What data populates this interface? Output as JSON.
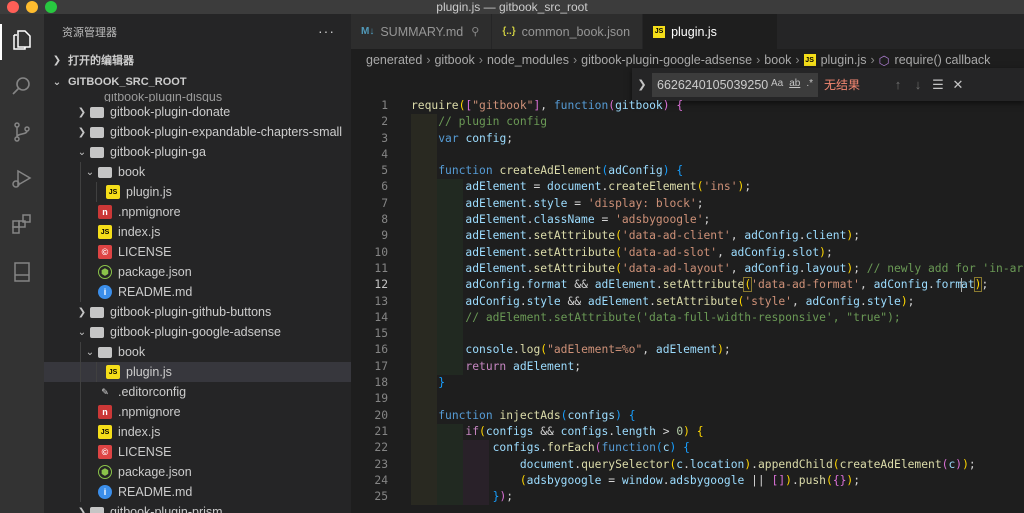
{
  "window": {
    "title": "plugin.js — gitbook_src_root"
  },
  "sidebar": {
    "header": "资源管理器",
    "more": "···",
    "open_editors": "打开的编辑器",
    "root": "GITBOOK_SRC_ROOT",
    "partial": "gitbook-plugin-disqus",
    "items": [
      {
        "label": "gitbook-plugin-donate"
      },
      {
        "label": "gitbook-plugin-expandable-chapters-small"
      },
      {
        "label": "gitbook-plugin-ga"
      },
      {
        "label": "book"
      },
      {
        "label": "plugin.js"
      },
      {
        "label": ".npmignore"
      },
      {
        "label": "index.js"
      },
      {
        "label": "LICENSE"
      },
      {
        "label": "package.json"
      },
      {
        "label": "README.md"
      },
      {
        "label": "gitbook-plugin-github-buttons"
      },
      {
        "label": "gitbook-plugin-google-adsense"
      },
      {
        "label": "book"
      },
      {
        "label": "plugin.js"
      },
      {
        "label": ".editorconfig"
      },
      {
        "label": ".npmignore"
      },
      {
        "label": "index.js"
      },
      {
        "label": "LICENSE"
      },
      {
        "label": "package.json"
      },
      {
        "label": "README.md"
      },
      {
        "label": "gitbook-plugin-prism"
      }
    ]
  },
  "tabs": [
    {
      "icon": "M↓",
      "label": "SUMMARY.md",
      "color": "#519aba"
    },
    {
      "icon": "{..}",
      "label": "common_book.json",
      "color": "#cbcb41"
    },
    {
      "icon": "JS",
      "label": "plugin.js",
      "color": "#f5de19"
    }
  ],
  "breadcrumb": [
    "generated",
    "gitbook",
    "node_modules",
    "gitbook-plugin-google-adsense",
    "book",
    "plugin.js",
    "require() callback"
  ],
  "find": {
    "query": "6626240105039250",
    "opt_case": "Aa",
    "opt_word": "ab",
    "opt_regex": ".*",
    "result": "无结果"
  },
  "editor": {
    "current_line": 12,
    "line_numbers": [
      "1",
      "2",
      "3",
      "4",
      "5",
      "6",
      "7",
      "8",
      "9",
      "10",
      "11",
      "12",
      "13",
      "14",
      "15",
      "16",
      "17",
      "18",
      "19",
      "20",
      "21",
      "22",
      "23",
      "24",
      "25"
    ]
  },
  "colors": {
    "accent": "#007acc",
    "selected": "#37373d",
    "no_result": "#f48771"
  }
}
